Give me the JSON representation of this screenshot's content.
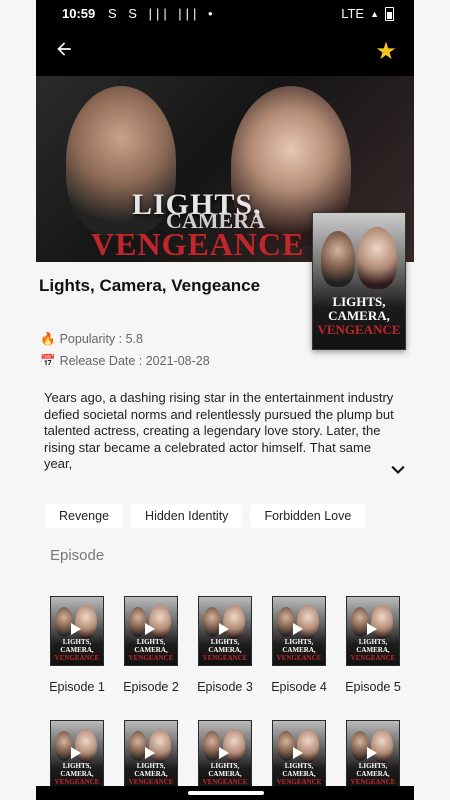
{
  "status_bar": {
    "time": "10:59",
    "icons": "S S ||| ||| •",
    "network": "LTE",
    "signal": "▲"
  },
  "app_bar": {
    "back_icon": "arrow-back-icon",
    "favorite_icon": "star-icon",
    "favorite_color": "#f6c21d"
  },
  "hero": {
    "line1": "LIGHTS,",
    "line2": "CAMERA",
    "line3": "VENGEANCE"
  },
  "poster": {
    "line1": "LIGHTS,",
    "line2": "CAMERA,",
    "line3": "VENGEANCE"
  },
  "show": {
    "title": "Lights, Camera, Vengeance",
    "popularity_icon": "🔥",
    "popularity": "Popularity : 5.8",
    "release_icon": "📅",
    "release_date": "Release Date : 2021-08-28",
    "description": "Years ago, a dashing rising star in the entertainment industry defied societal norms and relentlessly pursued the plump but talented actress, creating a legendary love story. Later, the rising star became a celebrated actor himself. That same year,"
  },
  "tags": [
    "Revenge",
    "Hidden Identity",
    "Forbidden Love"
  ],
  "episodes_section": {
    "title": "Episode",
    "items": [
      {
        "label": "Episode 1"
      },
      {
        "label": "Episode 2"
      },
      {
        "label": "Episode 3"
      },
      {
        "label": "Episode 4"
      },
      {
        "label": "Episode 5"
      }
    ],
    "thumb_text": [
      "LIGHTS,",
      "CAMERA,",
      "VENGEANCE"
    ]
  },
  "colors": {
    "accent_star": "#f6c21d",
    "vengeance_red": "#c1262b",
    "background": "#f6f6f6"
  }
}
